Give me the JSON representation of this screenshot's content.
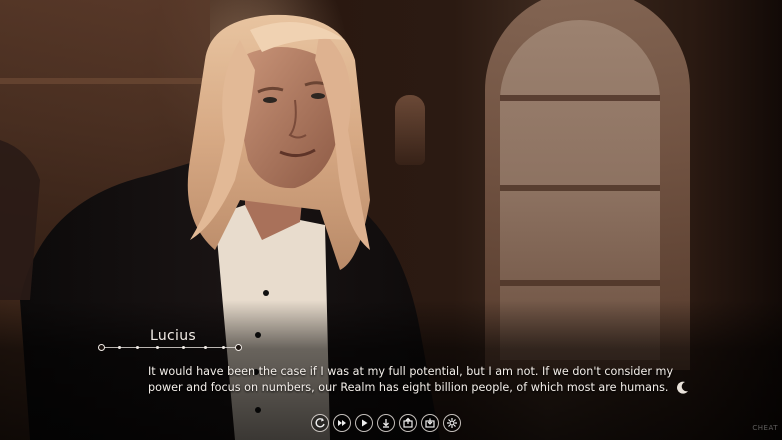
{
  "dialogue": {
    "speaker": "Lucius",
    "text": "It would have been the case if I was at my full potential, but I am not. If we don't consider my power and focus on numbers, our Realm has eight billion people, of which most are humans."
  },
  "quick_menu": [
    {
      "id": "rollback",
      "icon": "rollback-icon"
    },
    {
      "id": "skip",
      "icon": "fast-forward-icon"
    },
    {
      "id": "auto",
      "icon": "play-icon"
    },
    {
      "id": "save",
      "icon": "save-icon"
    },
    {
      "id": "load",
      "icon": "load-icon"
    },
    {
      "id": "qsave",
      "icon": "quick-save-icon"
    },
    {
      "id": "settings",
      "icon": "gear-icon"
    }
  ],
  "watermark": "CHEAT",
  "colors": {
    "text": "#f4efea",
    "accent_line": "#e6e1dc"
  }
}
